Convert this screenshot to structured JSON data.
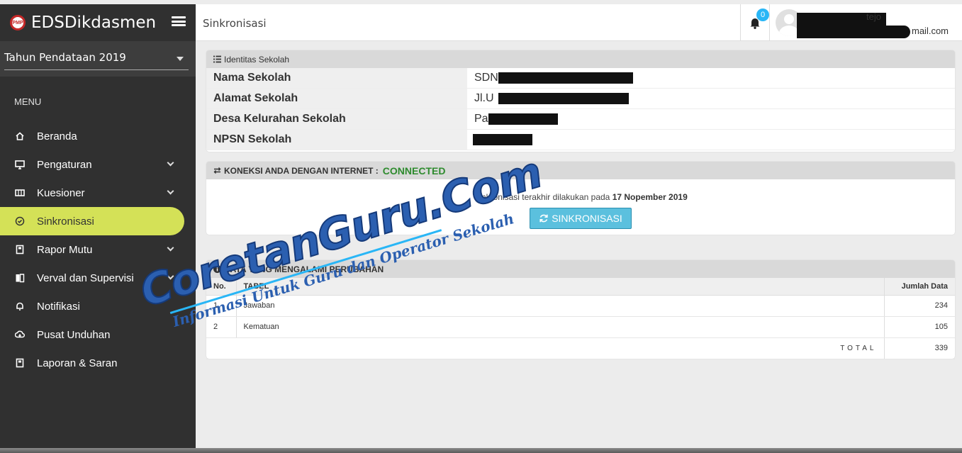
{
  "app": {
    "brand": "EDSDikdasmen",
    "logo_text": "PMP"
  },
  "year_select": {
    "value": "Tahun Pendataan 2019"
  },
  "sidebar": {
    "menu_label": "MENU",
    "items": [
      {
        "label": "Beranda",
        "icon": "home-icon"
      },
      {
        "label": "Pengaturan",
        "icon": "monitor-icon"
      },
      {
        "label": "Kuesioner",
        "icon": "ticket-icon"
      },
      {
        "label": "Sinkronisasi",
        "icon": "check-circle-icon"
      },
      {
        "label": "Rapor Mutu",
        "icon": "book-icon"
      },
      {
        "label": "Verval dan Supervisi",
        "icon": "book-open-icon"
      },
      {
        "label": "Notifikasi",
        "icon": "bell-icon"
      },
      {
        "label": "Pusat Unduhan",
        "icon": "cloud-download-icon"
      },
      {
        "label": "Laporan & Saran",
        "icon": "book-icon"
      }
    ]
  },
  "header": {
    "title": "Sinkronisasi",
    "notification_count": "0",
    "user_name_visible": "tejo",
    "user_email_visible": "mail.com"
  },
  "identity": {
    "title": "Identitas Sekolah",
    "rows": [
      {
        "key": "Nama Sekolah",
        "value": "SDN"
      },
      {
        "key": "Alamat Sekolah",
        "value": "Jl.U"
      },
      {
        "key": "Desa Kelurahan Sekolah",
        "value": "Pa"
      },
      {
        "key": "NPSN Sekolah",
        "value": ""
      }
    ]
  },
  "connection": {
    "title": "KONEKSI ANDA DENGAN INTERNET :",
    "status": "CONNECTED",
    "status_color": "#2e8b2e",
    "last_sync_prefix": "Sinkronisasi terakhir dilakukan pada",
    "last_sync_date": "17 Nopember 2019",
    "button_label": "SINKRONISASI"
  },
  "changes": {
    "title": "DATA YANG MENGALAMI PERUBAHAN",
    "columns": {
      "no": "No.",
      "table": "TABEL",
      "count": "Jumlah Data"
    },
    "rows": [
      {
        "no": "1",
        "table": "Jawaban",
        "count": "234"
      },
      {
        "no": "2",
        "table": "Kematuan",
        "count": "105"
      }
    ],
    "total_label": "TOTAL",
    "total_value": "339"
  },
  "watermark": {
    "main": "CoretanGuru.Com",
    "sub": "Informasi Untuk Guru dan Operator Sekolah"
  }
}
